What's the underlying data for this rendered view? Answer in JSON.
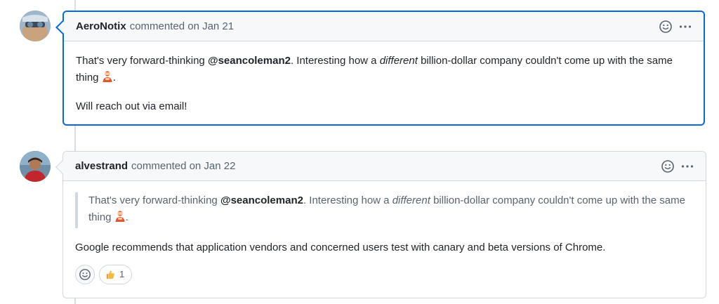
{
  "comments": [
    {
      "author": "AeroNotix",
      "meta": "commented on Jan 21",
      "paragraph1": {
        "before": "That's very forward-thinking ",
        "mention": "@seancoleman2",
        "mid": ". Interesting how a ",
        "em": "different",
        "after": " billion-dollar company couldn't come up with the same thing ",
        "end": "."
      },
      "paragraph2": "Will reach out via email!"
    },
    {
      "author": "alvestrand",
      "meta": "commented on Jan 22",
      "quote": {
        "before": "That's very forward-thinking ",
        "mention": "@seancoleman2",
        "mid": ". Interesting how a ",
        "em": "different",
        "after": " billion-dollar company couldn't come up with the same thing ",
        "end": "."
      },
      "paragraph": "Google recommends that application vendors and concerned users test with canary and beta versions of Chrome.",
      "reactions": [
        {
          "icon": "thumbs-up-icon",
          "count": "1"
        }
      ]
    }
  ],
  "colors": {
    "accent": "#0969da",
    "border": "#d0d7de",
    "header_bg": "#f6f8fa",
    "muted": "#59636e"
  }
}
